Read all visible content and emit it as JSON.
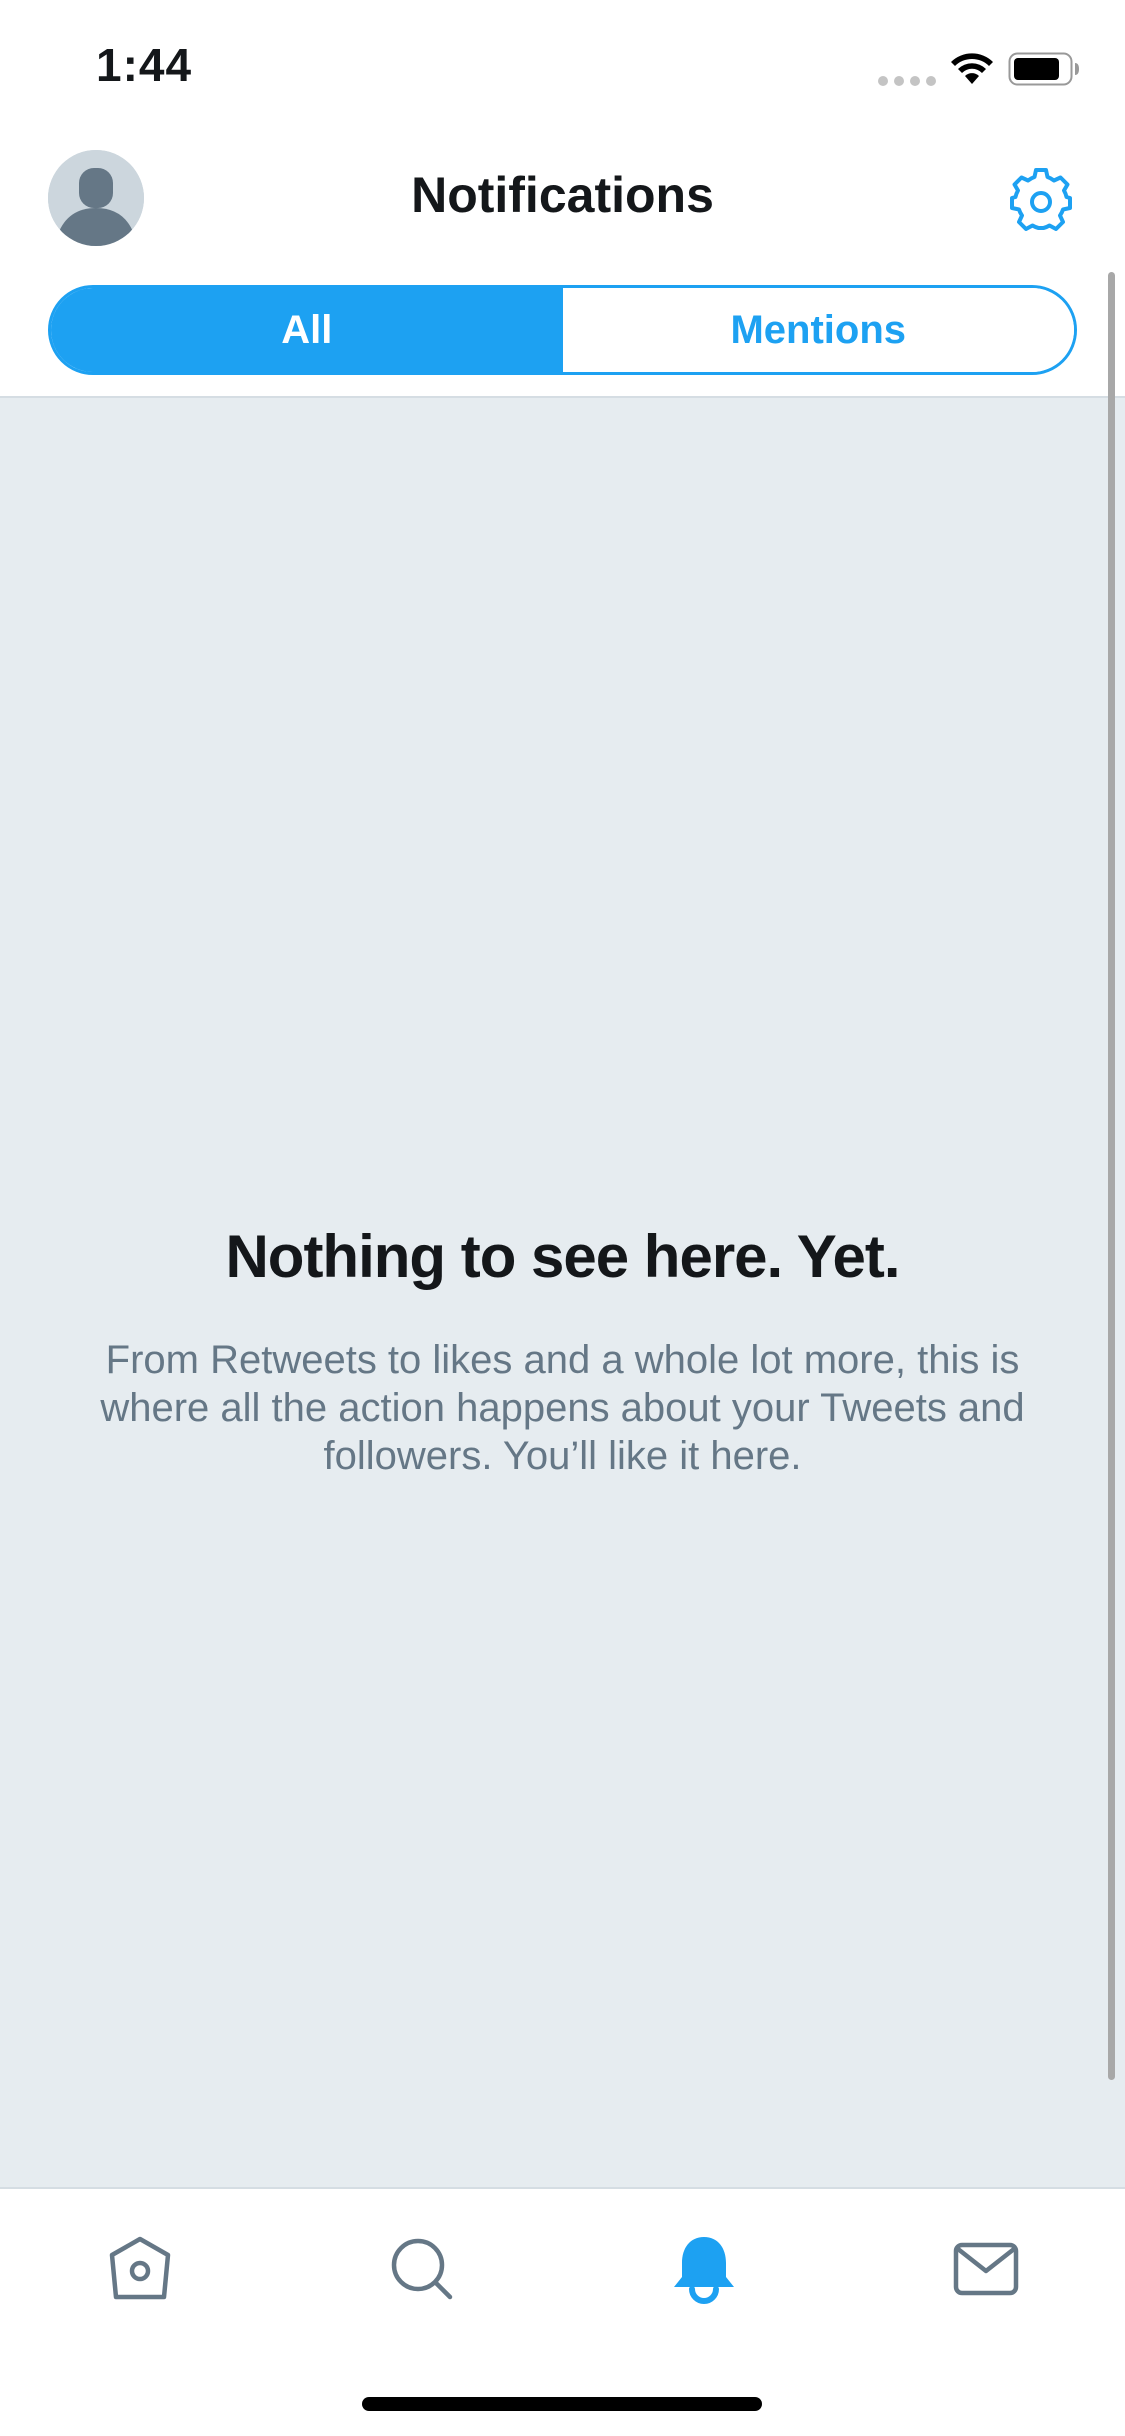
{
  "status_bar": {
    "time": "1:44"
  },
  "header": {
    "title": "Notifications",
    "avatar_icon": "default-avatar-icon",
    "settings_icon": "gear-icon"
  },
  "tabs": {
    "items": [
      {
        "label": "All",
        "active": true
      },
      {
        "label": "Mentions",
        "active": false
      }
    ]
  },
  "empty_state": {
    "title": "Nothing to see here. Yet.",
    "description": "From Retweets to likes and a whole lot more, this is where all the action happens about your Tweets and followers. You’ll like it here."
  },
  "tab_bar": {
    "items": [
      {
        "icon": "home-icon",
        "active": false
      },
      {
        "icon": "search-icon",
        "active": false
      },
      {
        "icon": "bell-icon",
        "active": true
      },
      {
        "icon": "mail-icon",
        "active": false
      }
    ]
  },
  "colors": {
    "accent": "#1da1f2",
    "background": "#e6ecf0",
    "text_primary": "#14171a",
    "text_secondary": "#657786",
    "icon_inactive": "#657786"
  }
}
